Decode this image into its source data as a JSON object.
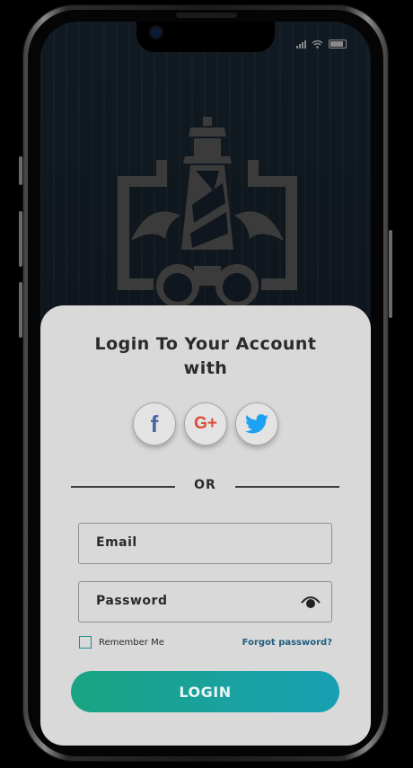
{
  "card": {
    "title_line1": "Login To Your Account",
    "title_line2": "with",
    "or_text": "OR",
    "email_label": "Email",
    "password_label": "Password",
    "remember_label": "Remember Me",
    "forgot_label": "Forgot password?",
    "login_label": "LOGIN"
  },
  "social": {
    "facebook_glyph": "f",
    "google_glyph": "G+"
  },
  "colors": {
    "accent_start": "#1aa483",
    "accent_end": "#18a0b3",
    "facebook": "#4a64a3",
    "google": "#dd4b39",
    "twitter": "#1da1f2",
    "link": "#1f5d80"
  },
  "icons": [
    "lighthouse-logo-icon",
    "facebook-icon",
    "google-plus-icon",
    "twitter-icon",
    "eye-icon",
    "signal-icon",
    "wifi-icon",
    "battery-icon"
  ]
}
